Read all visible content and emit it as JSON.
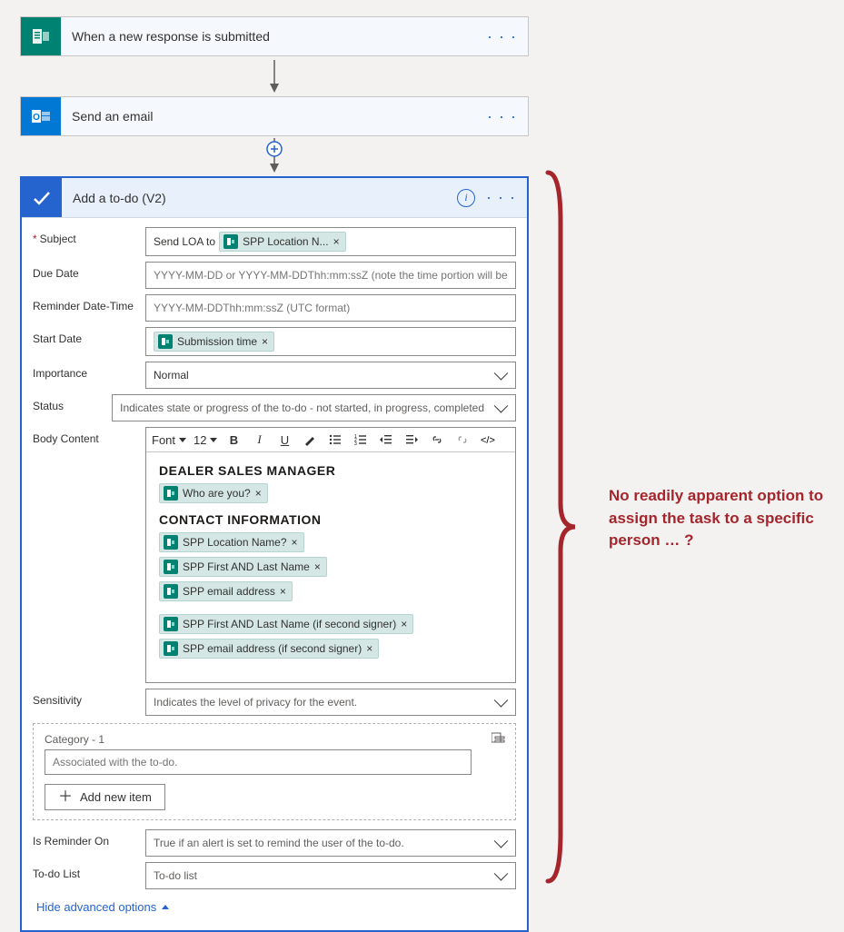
{
  "triggers": {
    "forms": {
      "title": "When a new response is submitted"
    },
    "email": {
      "title": "Send an email"
    },
    "todo": {
      "title": "Add a to-do (V2)"
    }
  },
  "form": {
    "subject": {
      "label": "Subject",
      "prefix_text": "Send LOA to",
      "token": "SPP Location N..."
    },
    "dueDate": {
      "label": "Due Date",
      "placeholder": "YYYY-MM-DD or YYYY-MM-DDThh:mm:ssZ (note the time portion will be ignored)"
    },
    "reminder": {
      "label": "Reminder Date-Time",
      "placeholder": "YYYY-MM-DDThh:mm:ssZ (UTC format)"
    },
    "startDate": {
      "label": "Start Date",
      "token": "Submission time"
    },
    "importance": {
      "label": "Importance",
      "value": "Normal"
    },
    "status": {
      "label": "Status",
      "placeholder": "Indicates state or progress of the to-do - not started, in progress, completed"
    },
    "bodyLabel": "Body Content",
    "body": {
      "font": "Font",
      "size": "12",
      "heading1": "DEALER SALES MANAGER",
      "token_who": "Who are you?",
      "heading2": "CONTACT INFORMATION",
      "tokens_group1": [
        "SPP Location Name?",
        "SPP First AND Last Name",
        "SPP email address"
      ],
      "tokens_group2": [
        "SPP First AND Last Name (if second signer)",
        "SPP email address (if second signer)"
      ]
    },
    "sensitivity": {
      "label": "Sensitivity",
      "placeholder": "Indicates the level of privacy for the event."
    },
    "category": {
      "label": "Category - 1",
      "placeholder": "Associated with the to-do.",
      "addItem": "Add new item"
    },
    "isReminder": {
      "label": "Is Reminder On",
      "placeholder": "True if an alert is set to remind the user of the to-do."
    },
    "todoList": {
      "label": "To-do List",
      "placeholder": "To-do list"
    },
    "advanced": "Hide advanced options"
  },
  "annotation": "No readily apparent option to assign the task to a specific person … ?"
}
